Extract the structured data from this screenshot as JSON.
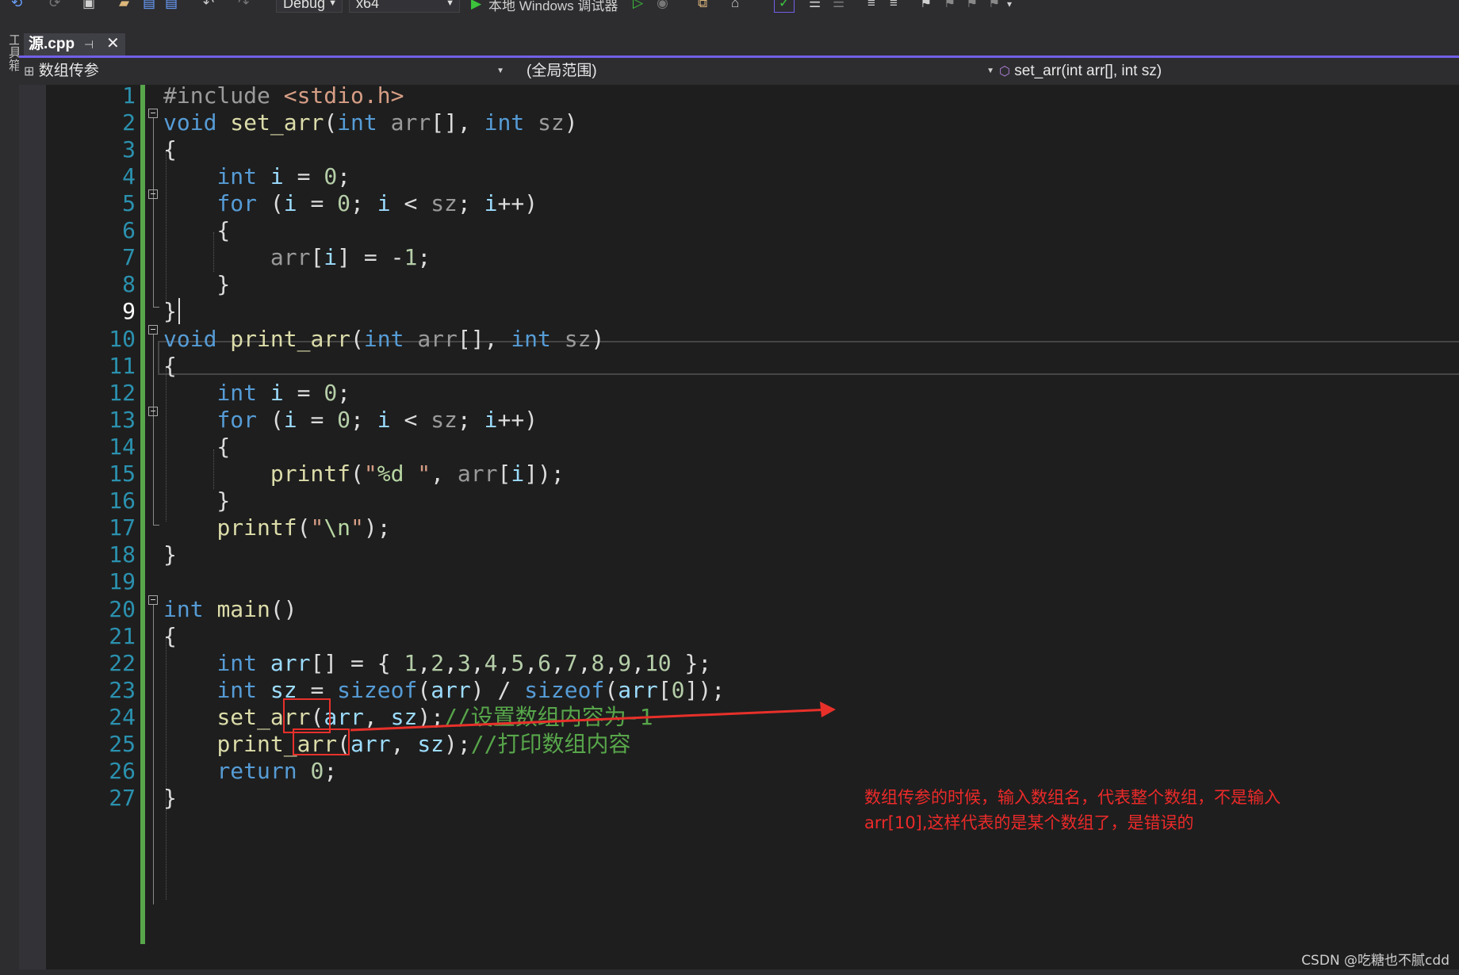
{
  "toolbar": {
    "config": "Debug",
    "platform": "x64",
    "run_label": "本地 Windows 调试器"
  },
  "toolbox_label": "工具箱",
  "tab": {
    "label": "源.cpp",
    "pin_glyph": "⊣",
    "close_glyph": "✕"
  },
  "navbar": {
    "project": "数组传参",
    "scope": "(全局范围)",
    "member": "set_arr(int arr[], int sz)"
  },
  "editor": {
    "current_line": 9,
    "line_numbers": [
      "1",
      "2",
      "3",
      "4",
      "5",
      "6",
      "7",
      "8",
      "9",
      "10",
      "11",
      "12",
      "13",
      "14",
      "15",
      "16",
      "17",
      "18",
      "19",
      "20",
      "21",
      "22",
      "23",
      "24",
      "25",
      "26",
      "27"
    ]
  },
  "annotation": {
    "line1": "数组传参的时候，输入数组名，代表整个数组，不是输入",
    "line2": "arr[10],这样代表的是某个数组了，是错误的"
  },
  "watermark": "CSDN @吃糖也不腻cdd",
  "colors": {
    "accent": "#7160e8",
    "annotation": "#ec2a2a",
    "changebar": "#57a64a",
    "keyword": "#569cd6",
    "comment": "#57a64a"
  }
}
